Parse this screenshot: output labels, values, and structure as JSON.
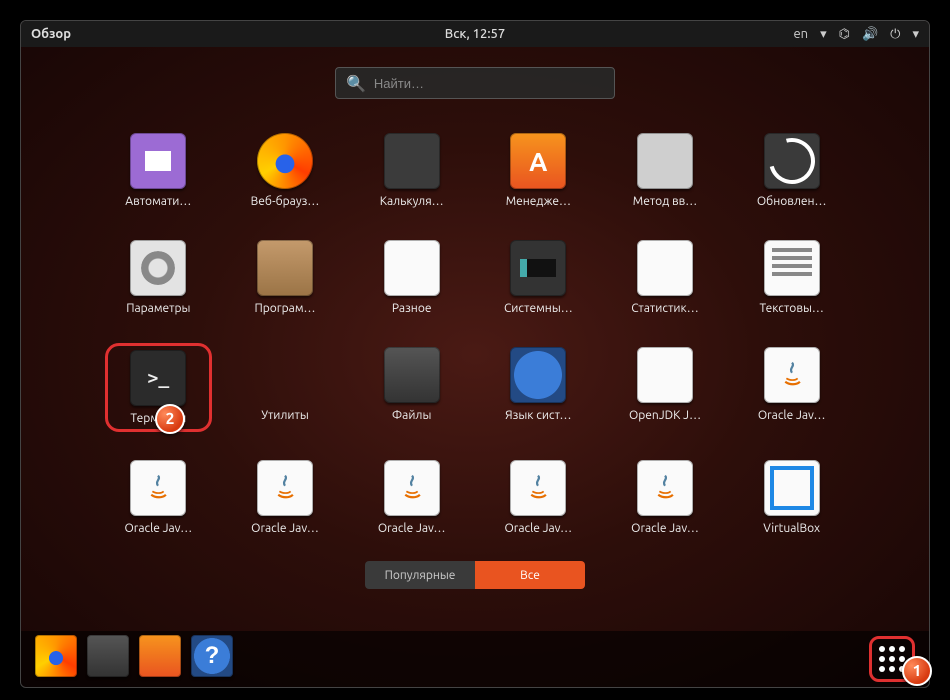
{
  "topbar": {
    "activities": "Обзор",
    "clock": "Вск, 12:57",
    "lang": "en"
  },
  "search": {
    "placeholder": "Найти…"
  },
  "apps": [
    {
      "label": "Автомати…",
      "icon": "i-auto",
      "name": "app-autostart"
    },
    {
      "label": "Веб-брауз…",
      "icon": "i-firefox",
      "name": "app-firefox"
    },
    {
      "label": "Калькуля…",
      "icon": "i-calc",
      "name": "app-calculator"
    },
    {
      "label": "Менедже…",
      "icon": "i-soft",
      "name": "app-software"
    },
    {
      "label": "Метод вв…",
      "icon": "i-kbd",
      "name": "app-input-method"
    },
    {
      "label": "Обновлен…",
      "icon": "i-update",
      "name": "app-updates"
    },
    {
      "label": "Параметры",
      "icon": "i-settings",
      "name": "app-settings"
    },
    {
      "label": "Програм…",
      "icon": "i-box",
      "name": "app-software-props"
    },
    {
      "label": "Разное",
      "icon": "i-misc",
      "name": "folder-misc"
    },
    {
      "label": "Системны…",
      "icon": "i-mon",
      "name": "app-system-monitor"
    },
    {
      "label": "Статистик…",
      "icon": "i-stat",
      "name": "app-stats"
    },
    {
      "label": "Текстовы…",
      "icon": "i-text",
      "name": "app-text-editor"
    },
    {
      "label": "Терминал",
      "icon": "i-term",
      "name": "app-terminal",
      "hl": true
    },
    {
      "label": "Утилиты",
      "icon": "i-util",
      "name": "folder-utilities"
    },
    {
      "label": "Файлы",
      "icon": "i-files",
      "name": "app-files"
    },
    {
      "label": "Язык сист…",
      "icon": "i-globe",
      "name": "app-language"
    },
    {
      "label": "OpenJDK J…",
      "icon": "i-duke",
      "name": "app-openjdk"
    },
    {
      "label": "Oracle Jav…",
      "icon": "i-java",
      "name": "app-oracle-java-1"
    },
    {
      "label": "Oracle Jav…",
      "icon": "i-java",
      "name": "app-oracle-java-2"
    },
    {
      "label": "Oracle Jav…",
      "icon": "i-java",
      "name": "app-oracle-java-3"
    },
    {
      "label": "Oracle Jav…",
      "icon": "i-java",
      "name": "app-oracle-java-4"
    },
    {
      "label": "Oracle Jav…",
      "icon": "i-java",
      "name": "app-oracle-java-5"
    },
    {
      "label": "Oracle Jav…",
      "icon": "i-java",
      "name": "app-oracle-java-6"
    },
    {
      "label": "VirtualBox",
      "icon": "i-vbox",
      "name": "app-virtualbox"
    }
  ],
  "toggle": {
    "inactive": "Популярные",
    "active": "Все"
  },
  "dock": [
    {
      "icon": "i-firefox",
      "name": "dock-firefox"
    },
    {
      "icon": "i-files",
      "name": "dock-files"
    },
    {
      "icon": "i-amazon",
      "name": "dock-software"
    },
    {
      "icon": "i-help",
      "name": "dock-help"
    }
  ],
  "badges": {
    "one": "1",
    "two": "2"
  }
}
